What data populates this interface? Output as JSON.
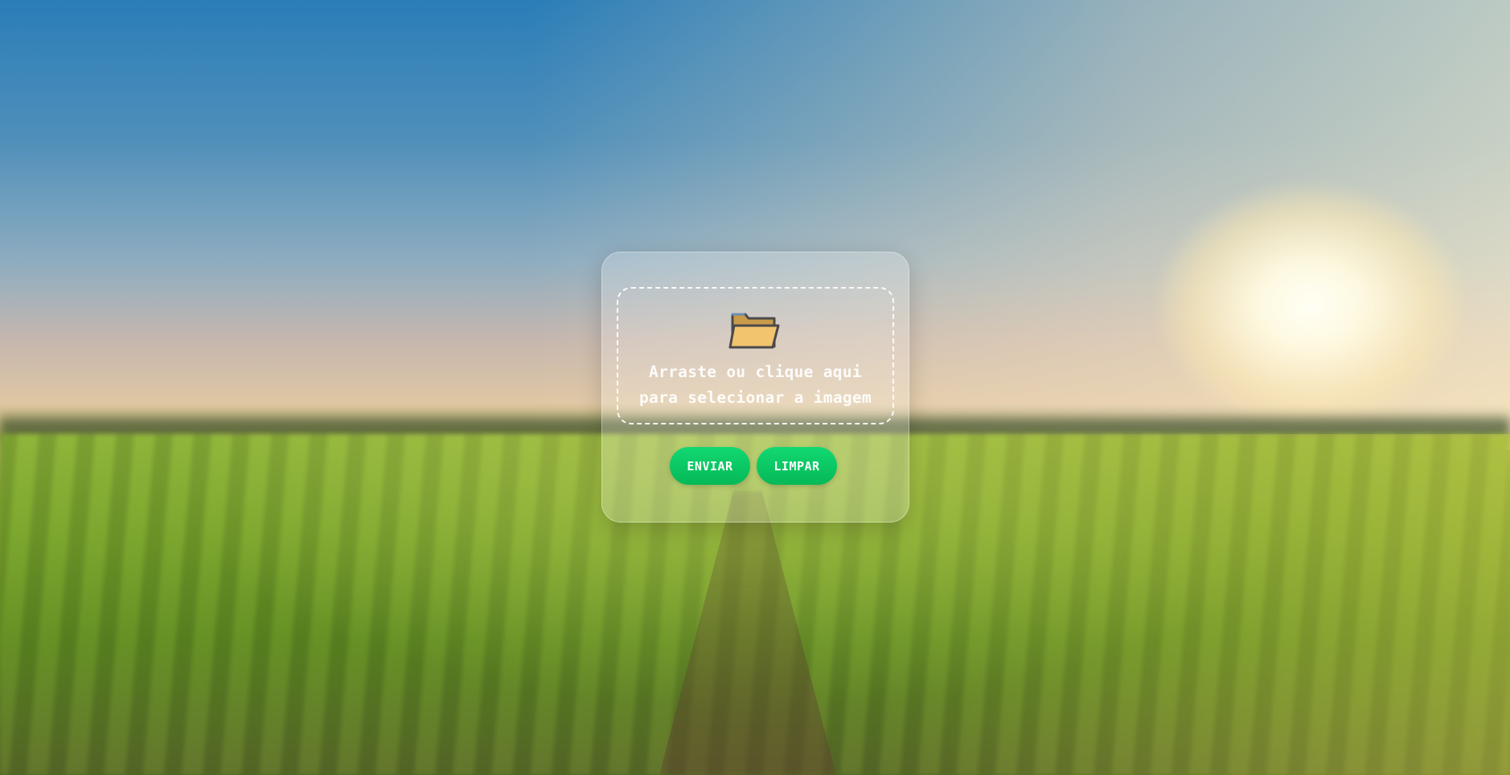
{
  "upload": {
    "dropzone_line1": "Arraste ou clique aqui",
    "dropzone_line2": "para selecionar a imagem",
    "icon": "folder-icon"
  },
  "actions": {
    "send_label": "ENVIAR",
    "clear_label": "LIMPAR"
  },
  "colors": {
    "button_green": "#0bc964",
    "card_glass": "rgba(255,255,255,0.22)"
  }
}
